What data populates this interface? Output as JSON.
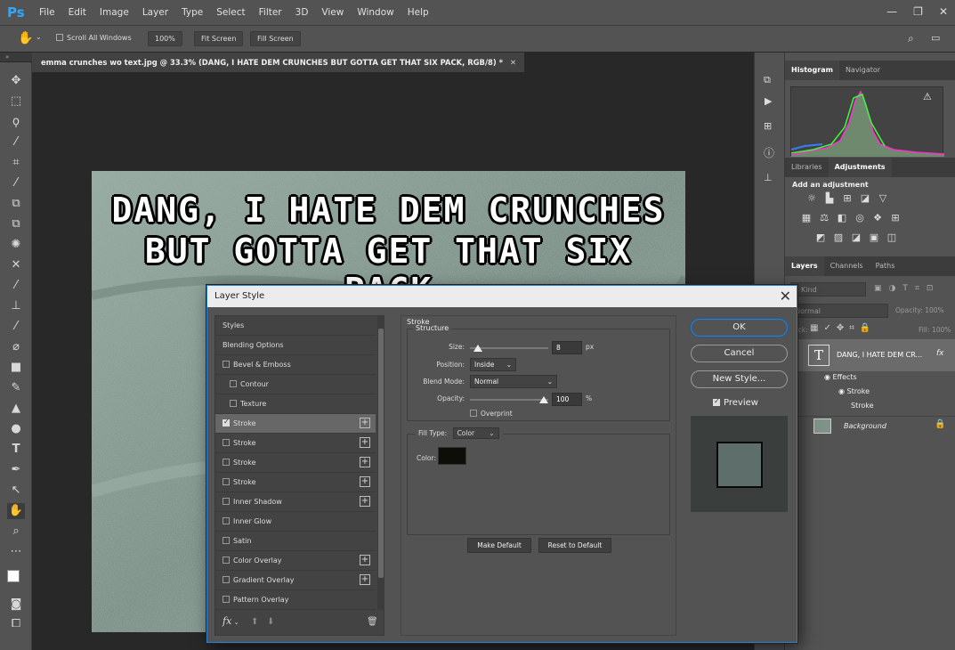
{
  "app": {
    "logo": "Ps"
  },
  "menubar": {
    "items": [
      "File",
      "Edit",
      "Image",
      "Layer",
      "Type",
      "Select",
      "Filter",
      "3D",
      "View",
      "Window",
      "Help"
    ]
  },
  "options": {
    "scroll_all": "Scroll All Windows",
    "zoom": "100%",
    "fit": "Fit Screen",
    "fill": "Fill Screen"
  },
  "document": {
    "tab_title": "emma crunches wo text.jpg @ 33.3% (DANG, I HATE DEM CRUNCHES BUT GOTTA GET THAT SIX PACK, RGB/8) *",
    "line1": "DANG, I HATE DEM CRUNCHES",
    "line2": "BUT GOTTA GET THAT SIX PACK"
  },
  "panels": {
    "top_tabs": [
      "Histogram",
      "Navigator"
    ],
    "mid_tabs": [
      "Libraries",
      "Adjustments"
    ],
    "add_adjustment": "Add an adjustment",
    "layer_tabs": [
      "Layers",
      "Channels",
      "Paths"
    ],
    "kind": "Kind",
    "blend": "Normal",
    "opacity_label": "Opacity:",
    "opacity_value": "100%",
    "lock_label": "Lock:",
    "fill_label": "Fill:",
    "fill_value": "100%",
    "layers": {
      "text_layer": "DANG, I HATE DEM CR...",
      "effects": "Effects",
      "stroke1": "Stroke",
      "stroke2": "Stroke",
      "background": "Background"
    }
  },
  "dialog": {
    "title": "Layer Style",
    "styles": [
      {
        "label": "Styles",
        "check": false,
        "plus": false,
        "indent": false,
        "nocheck": true
      },
      {
        "label": "Blending Options",
        "check": false,
        "plus": false,
        "indent": false,
        "nocheck": true
      },
      {
        "label": "Bevel & Emboss",
        "check": false,
        "plus": false,
        "indent": false
      },
      {
        "label": "Contour",
        "check": false,
        "plus": false,
        "indent": true
      },
      {
        "label": "Texture",
        "check": false,
        "plus": false,
        "indent": true
      },
      {
        "label": "Stroke",
        "check": true,
        "plus": true,
        "indent": false,
        "selected": true
      },
      {
        "label": "Stroke",
        "check": false,
        "plus": true,
        "indent": false
      },
      {
        "label": "Stroke",
        "check": false,
        "plus": true,
        "indent": false
      },
      {
        "label": "Stroke",
        "check": false,
        "plus": true,
        "indent": false
      },
      {
        "label": "Inner Shadow",
        "check": false,
        "plus": true,
        "indent": false
      },
      {
        "label": "Inner Glow",
        "check": false,
        "plus": false,
        "indent": false
      },
      {
        "label": "Satin",
        "check": false,
        "plus": false,
        "indent": false
      },
      {
        "label": "Color Overlay",
        "check": false,
        "plus": true,
        "indent": false
      },
      {
        "label": "Gradient Overlay",
        "check": false,
        "plus": true,
        "indent": false
      },
      {
        "label": "Pattern Overlay",
        "check": false,
        "plus": false,
        "indent": false
      }
    ],
    "stroke": {
      "title": "Stroke",
      "structure": "Structure",
      "size_label": "Size:",
      "size_value": "8",
      "size_unit": "px",
      "position_label": "Position:",
      "position_value": "Inside",
      "blend_label": "Blend Mode:",
      "blend_value": "Normal",
      "opacity_label": "Opacity:",
      "opacity_value": "100",
      "opacity_unit": "%",
      "overprint": "Overprint",
      "fill_type_label": "Fill Type:",
      "fill_type_value": "Color",
      "color_label": "Color:",
      "color_swatch": "#0e0e08",
      "make_default": "Make Default",
      "reset_default": "Reset to Default"
    },
    "ok": "OK",
    "cancel": "Cancel",
    "new_style": "New Style...",
    "preview": "Preview",
    "fx": "fx"
  }
}
